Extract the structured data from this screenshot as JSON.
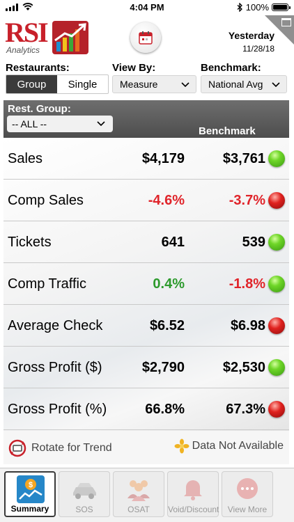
{
  "status_bar": {
    "time": "4:04 PM",
    "battery": "100%"
  },
  "header": {
    "logo_text": "RSI",
    "logo_sub": "Analytics",
    "date_label": "Yesterday",
    "date_value": "11/28/18"
  },
  "filters": {
    "restaurants_label": "Restaurants:",
    "segments": [
      "Group",
      "Single"
    ],
    "selected_segment": "Group",
    "view_by_label": "View By:",
    "view_by_value": "Measure",
    "benchmark_label": "Benchmark:",
    "benchmark_value": "National Avg"
  },
  "table_header": {
    "rest_group_label": "Rest. Group:",
    "rest_group_value": "-- ALL --",
    "benchmark_col": "Benchmark"
  },
  "metrics": [
    {
      "label": "Sales",
      "value": "$4,179",
      "value_color": "#000000",
      "benchmark": "$3,761",
      "benchmark_color": "#000000",
      "status": "green"
    },
    {
      "label": "Comp Sales",
      "value": "-4.6%",
      "value_color": "#e0242a",
      "benchmark": "-3.7%",
      "benchmark_color": "#e0242a",
      "status": "red"
    },
    {
      "label": "Tickets",
      "value": "641",
      "value_color": "#000000",
      "benchmark": "539",
      "benchmark_color": "#000000",
      "status": "green"
    },
    {
      "label": "Comp Traffic",
      "value": "0.4%",
      "value_color": "#2c9a2c",
      "benchmark": "-1.8%",
      "benchmark_color": "#e0242a",
      "status": "green"
    },
    {
      "label": "Average Check",
      "value": "$6.52",
      "value_color": "#000000",
      "benchmark": "$6.98",
      "benchmark_color": "#000000",
      "status": "red"
    },
    {
      "label": "Gross Profit ($)",
      "value": "$2,790",
      "value_color": "#000000",
      "benchmark": "$2,530",
      "benchmark_color": "#000000",
      "status": "green"
    },
    {
      "label": "Gross Profit (%)",
      "value": "66.8%",
      "value_color": "#000000",
      "benchmark": "67.3%",
      "benchmark_color": "#000000",
      "status": "red"
    }
  ],
  "legend": {
    "rotate_text": "Rotate for Trend",
    "na_text": "Data Not Available"
  },
  "tabs": [
    {
      "label": "Summary",
      "icon": "summary-chart-icon",
      "active": true
    },
    {
      "label": "SOS",
      "icon": "car-icon",
      "active": false
    },
    {
      "label": "OSAT",
      "icon": "people-icon",
      "active": false
    },
    {
      "label": "Void/Discount",
      "icon": "bell-icon",
      "active": false
    },
    {
      "label": "View More",
      "icon": "more-icon",
      "active": false
    }
  ],
  "colors": {
    "brand_red": "#b5222a",
    "status_green": "#4cbb17",
    "status_red": "#d01818",
    "header_gray": "#5a5a5a"
  }
}
